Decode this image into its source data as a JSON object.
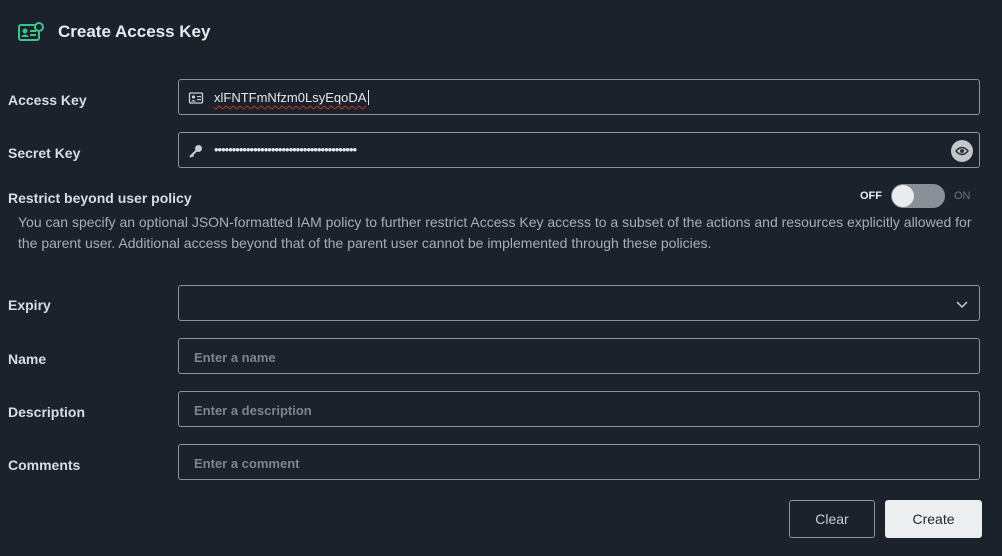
{
  "header": {
    "title": "Create Access Key",
    "icon": "access-key-icon",
    "icon_color": "#3ec48a"
  },
  "access_key": {
    "label": "Access Key",
    "value": "xlFNTFmNfzm0LsyEqoDA",
    "icon": "id-card-icon"
  },
  "secret_key": {
    "label": "Secret Key",
    "masked_value": "••••••••••••••••••••••••••••••••••••••••",
    "icon": "key-icon",
    "reveal_icon": "eye-icon"
  },
  "restrict": {
    "label": "Restrict beyond user policy",
    "toggle_off_label": "OFF",
    "toggle_on_label": "ON",
    "enabled": false,
    "description": "You can specify an optional JSON-formatted IAM policy to further restrict Access Key access to a subset of the actions and resources explicitly allowed for the parent user. Additional access beyond that of the parent user cannot be implemented through these policies."
  },
  "expiry": {
    "label": "Expiry",
    "value": "",
    "icon": "chevron-down-icon"
  },
  "name": {
    "label": "Name",
    "placeholder": "Enter a name"
  },
  "description_field": {
    "label": "Description",
    "placeholder": "Enter a description"
  },
  "comments": {
    "label": "Comments",
    "placeholder": "Enter a comment"
  },
  "buttons": {
    "clear": "Clear",
    "create": "Create"
  }
}
